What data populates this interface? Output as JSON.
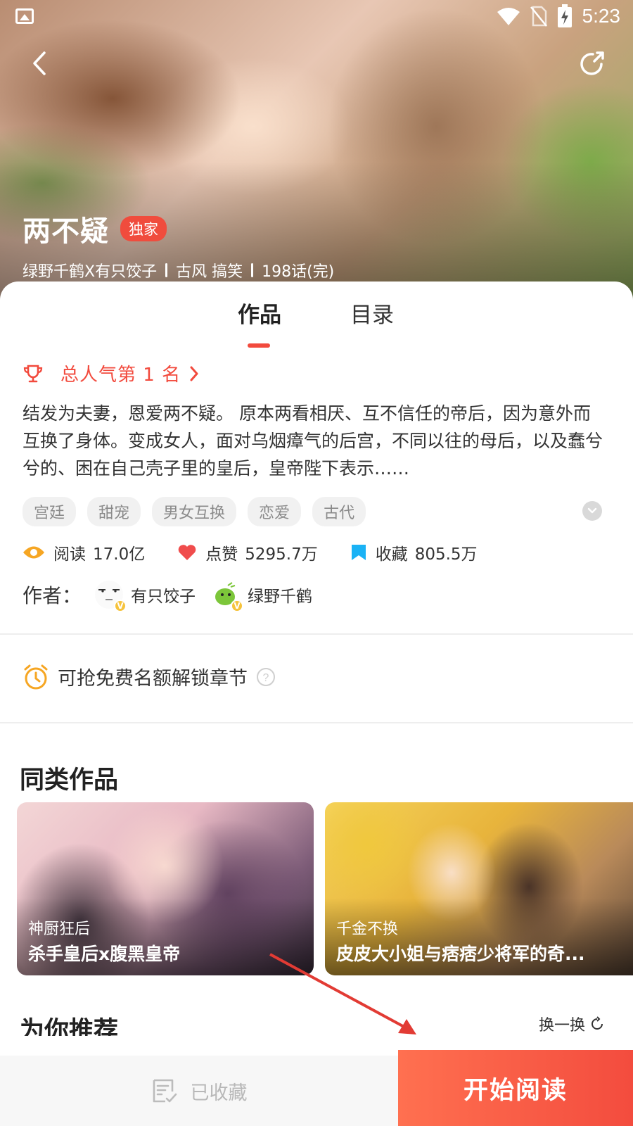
{
  "status_bar": {
    "time": "5:23"
  },
  "hero": {
    "title": "两不疑",
    "badge": "独家",
    "authors_line": "绿野千鹤X有只饺子",
    "genres": "古风 搞笑",
    "episodes": "198话(完)"
  },
  "tabs": [
    {
      "label": "作品",
      "active": true
    },
    {
      "label": "目录",
      "active": false
    }
  ],
  "rank": {
    "text": "总人气第 1 名"
  },
  "description": "结发为夫妻，恩爱两不疑。 原本两看相厌、互不信任的帝后，因为意外而互换了身体。变成女人，面对乌烟瘴气的后宫，不同以往的母后，以及蠢兮兮的、困在自己壳子里的皇后，皇帝陛下表示……",
  "tags": [
    "宫廷",
    "甜宠",
    "男女互换",
    "恋爱",
    "古代"
  ],
  "stats": {
    "read_label": "阅读",
    "read_value": "17.0亿",
    "like_label": "点赞",
    "like_value": "5295.7万",
    "collect_label": "收藏",
    "collect_value": "805.5万"
  },
  "authors": {
    "label": "作者：",
    "list": [
      {
        "name": "有只饺子",
        "badge": "V"
      },
      {
        "name": "绿野千鹤",
        "badge": "V"
      }
    ]
  },
  "free_unlock": {
    "text": "可抢免费名额解锁章节",
    "help_icon": "?"
  },
  "similar": {
    "title": "同类作品",
    "cards": [
      {
        "subtitle": "神厨狂后",
        "title": "杀手皇后x腹黑皇帝"
      },
      {
        "subtitle": "千金不换",
        "title": "皮皮大小姐与痞痞少将军的奇..."
      }
    ]
  },
  "recommend": {
    "title": "为你推荐",
    "refresh": "换一换"
  },
  "bottom_bar": {
    "collect_label": "已收藏",
    "read_label": "开始阅读"
  },
  "colors": {
    "accent": "#f24a3d",
    "star": "#f6a623",
    "heart": "#f04c4c",
    "bookmark": "#1ab2f5"
  }
}
